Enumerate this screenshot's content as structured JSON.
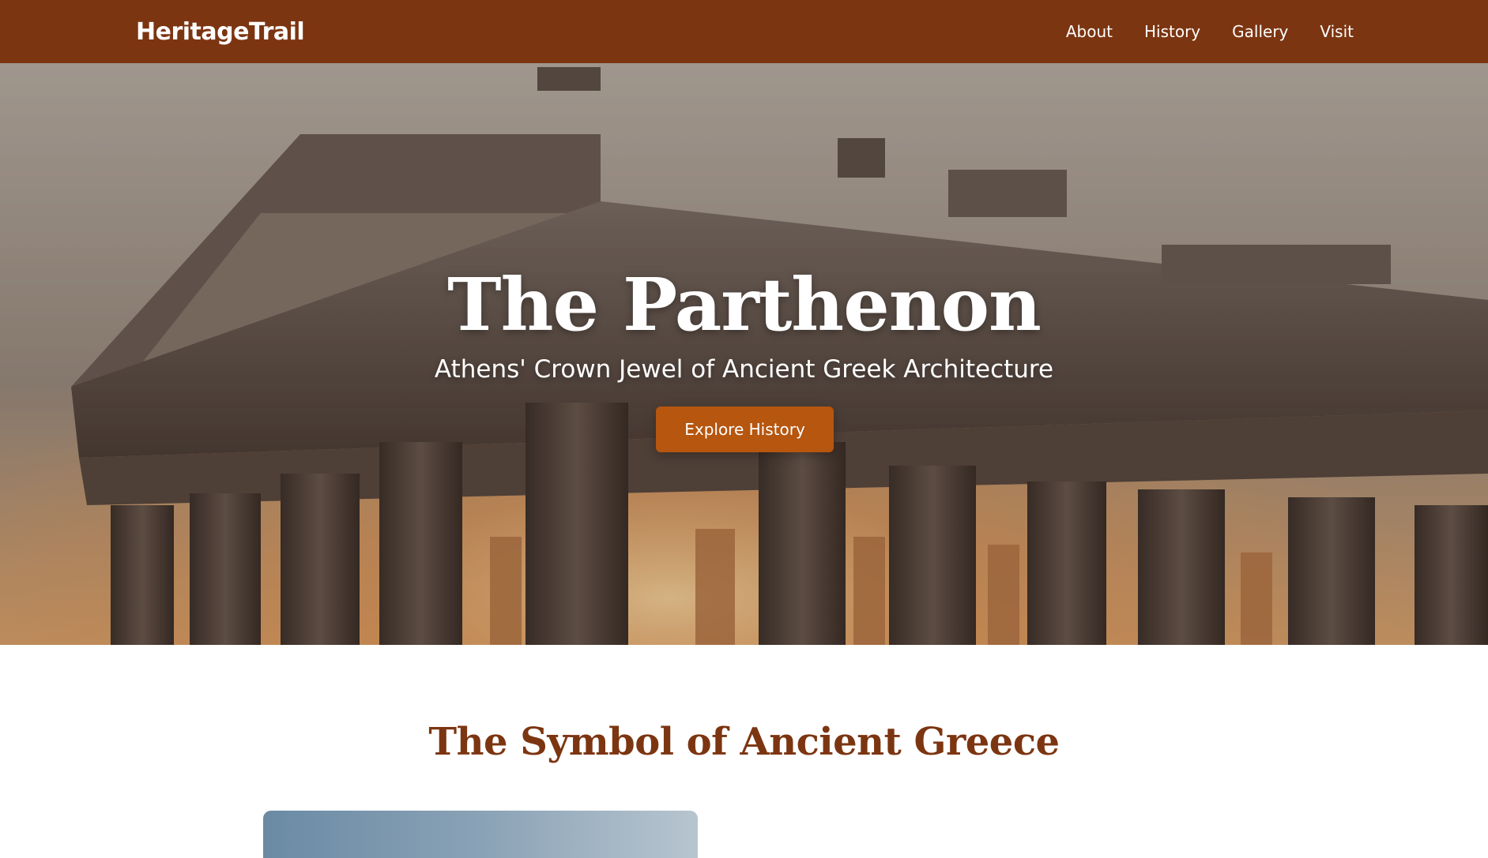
{
  "header": {
    "logo": "HeritageTrail",
    "nav": [
      {
        "label": "About"
      },
      {
        "label": "History"
      },
      {
        "label": "Gallery"
      },
      {
        "label": "Visit"
      }
    ]
  },
  "hero": {
    "title": "The Parthenon",
    "subtitle": "Athens' Crown Jewel of Ancient Greek Architecture",
    "button_label": "Explore History"
  },
  "section": {
    "title": "The Symbol of Ancient Greece"
  },
  "colors": {
    "brand": "#7c3511",
    "accent": "#b6560f",
    "text_on_dark": "#ffffff"
  }
}
